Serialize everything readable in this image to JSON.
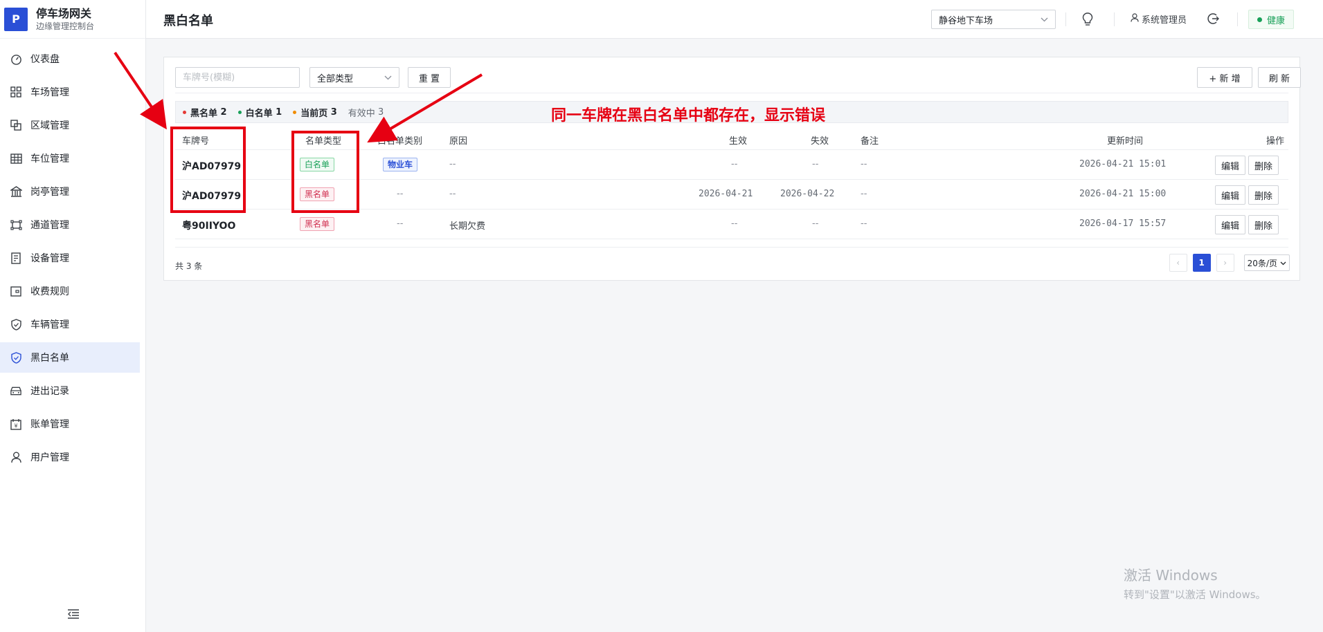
{
  "brand": {
    "logo": "P",
    "title": "停车场网关",
    "subtitle": "边缘管理控制台"
  },
  "sidebar": {
    "items": [
      {
        "label": "仪表盘",
        "icon": "dashboard-icon"
      },
      {
        "label": "车场管理",
        "icon": "grid-icon"
      },
      {
        "label": "区域管理",
        "icon": "layers-icon"
      },
      {
        "label": "车位管理",
        "icon": "table-icon"
      },
      {
        "label": "岗亭管理",
        "icon": "building-icon"
      },
      {
        "label": "通道管理",
        "icon": "channel-icon"
      },
      {
        "label": "设备管理",
        "icon": "device-icon"
      },
      {
        "label": "收费规则",
        "icon": "wallet-icon"
      },
      {
        "label": "车辆管理",
        "icon": "shield-icon"
      },
      {
        "label": "黑白名单",
        "icon": "shield-check-icon",
        "active": true
      },
      {
        "label": "进出记录",
        "icon": "car-icon"
      },
      {
        "label": "账单管理",
        "icon": "bill-icon"
      },
      {
        "label": "用户管理",
        "icon": "user-icon"
      }
    ],
    "collapse_icon": "menu-fold-icon"
  },
  "header": {
    "title": "黑白名单",
    "lot": "静谷地下车场",
    "user": "系统管理员",
    "health": "健康"
  },
  "toolbar": {
    "search_placeholder": "车牌号(模糊)",
    "type_select": "全部类型",
    "reset": "重 置",
    "add": "+ 新 增",
    "refresh": "刷 新"
  },
  "summary": {
    "black_label": "黑名单",
    "black_count": "2",
    "white_label": "白名单",
    "white_count": "1",
    "page_label": "当前页",
    "page_count": "3",
    "active_label": "有效中",
    "active_count": "3"
  },
  "table": {
    "columns": {
      "plate": "车牌号",
      "type": "名单类型",
      "category": "白名单类别",
      "reason": "原因",
      "start": "生效",
      "end": "失效",
      "note": "备注",
      "updated": "更新时间",
      "ops": "操作"
    },
    "rows": [
      {
        "plate": "沪AD07979",
        "type": "白名单",
        "category": "物业车",
        "reason": "--",
        "start": "--",
        "end": "--",
        "note": "--",
        "updated": "2026-04-21 15:01",
        "edit": "编辑",
        "delete": "删除"
      },
      {
        "plate": "沪AD07979",
        "type": "黑名单",
        "category": "--",
        "reason": "--",
        "start": "2026-04-21",
        "end": "2026-04-22",
        "note": "--",
        "updated": "2026-04-21 15:00",
        "edit": "编辑",
        "delete": "删除"
      },
      {
        "plate": "粤90IIYOO",
        "type": "黑名单",
        "category": "--",
        "reason": "长期欠费",
        "start": "--",
        "end": "--",
        "note": "--",
        "updated": "2026-04-17 15:57",
        "edit": "编辑",
        "delete": "删除"
      }
    ]
  },
  "pagination": {
    "total": "共 3 条",
    "current": "1",
    "page_size": "20条/页"
  },
  "annotation": {
    "text": "同一车牌在黑白名单中都存在，显示错误"
  },
  "watermark": {
    "line1": "激活 Windows",
    "line2": "转到\"设置\"以激活 Windows。"
  },
  "colors": {
    "accent": "#2a4fd6",
    "annotation": "#e60012",
    "black_tag": "#d03050",
    "white_tag": "#18a058"
  }
}
